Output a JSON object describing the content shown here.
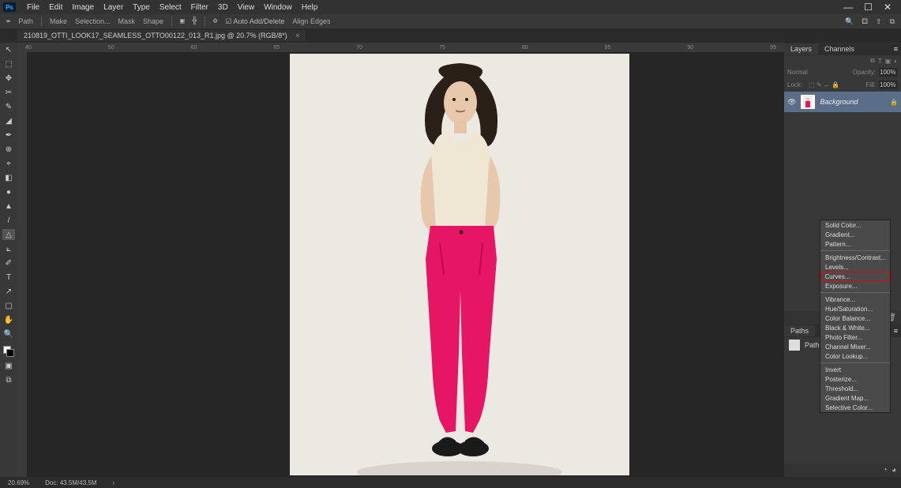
{
  "menubar": {
    "logo": "Ps",
    "items": [
      "File",
      "Edit",
      "Image",
      "Layer",
      "Type",
      "Select",
      "Filter",
      "3D",
      "View",
      "Window",
      "Help"
    ]
  },
  "winctrl": {
    "min": "—",
    "max": "☐",
    "close": "✕"
  },
  "optbar": {
    "mode": "Path",
    "ops1": "Make",
    "ops2": "Selection...",
    "ops3": "Mask",
    "ops4": "Shape",
    "auto": "Auto Add/Delete",
    "align": "Align Edges"
  },
  "searchIcons": {
    "search": "🔍",
    "grid": "⚃",
    "share": "⇪",
    "frame": "⧉"
  },
  "tab": {
    "name": "210819_OTTI_LOOK17_SEAMLESS_OTTO00122_013_R1.jpg @ 20.7% (RGB/8*)",
    "close": "×"
  },
  "ruler": {
    "marks": [
      "40",
      "50",
      "60",
      "65",
      "70",
      "75",
      "80",
      "85",
      "90",
      "95"
    ]
  },
  "tools": [
    "↖",
    "⬚",
    "✥",
    "✂",
    "✎",
    "◢",
    "✒",
    "⊕",
    "⌖",
    "◧",
    "●",
    "▲",
    "/",
    "△",
    "⟀",
    "✐",
    "T",
    "↗",
    "▢",
    "✋",
    "🔍"
  ],
  "layersPanel": {
    "tabs": [
      "Layers",
      "Channels"
    ],
    "opacityLabel": "Opacity:",
    "opacityVal": "100%",
    "fillLabel": "Fill:",
    "fillVal": "100%",
    "lockLabel": "Lock:",
    "layerName": "Background"
  },
  "pathsPanel": {
    "tab": "Paths",
    "rowName": "Path 1"
  },
  "footerIcons": [
    "⊚",
    "fx",
    "◐",
    "◧",
    "▣",
    "⊞",
    "🗑"
  ],
  "pathsFooter": [
    "◔",
    "◕"
  ],
  "status": {
    "zoom": "20.69%",
    "doc": "Doc: 43.5M/43.5M",
    "arrow": "›"
  },
  "context": {
    "g1": [
      "Solid Color...",
      "Gradient...",
      "Pattern..."
    ],
    "g2": [
      "Brightness/Contrast...",
      "Levels...",
      "Curves...",
      "Exposure..."
    ],
    "g3": [
      "Vibrance...",
      "Hue/Saturation...",
      "Color Balance...",
      "Black & White...",
      "Photo Filter...",
      "Channel Mixer...",
      "Color Lookup..."
    ],
    "g4": [
      "Invert",
      "Posterize...",
      "Threshold...",
      "Gradient Map...",
      "Selective Color..."
    ],
    "hl": "Curves..."
  }
}
